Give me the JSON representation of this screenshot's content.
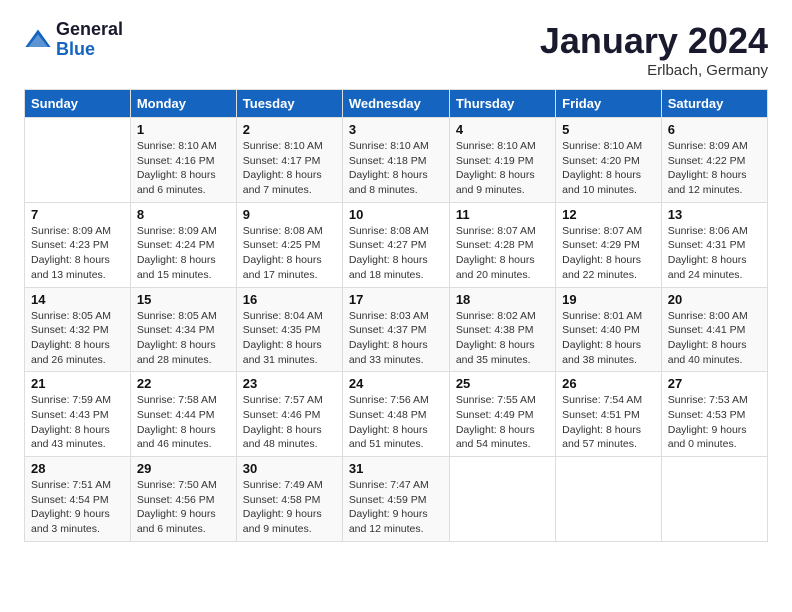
{
  "header": {
    "logo_general": "General",
    "logo_blue": "Blue",
    "month": "January 2024",
    "location": "Erlbach, Germany"
  },
  "weekdays": [
    "Sunday",
    "Monday",
    "Tuesday",
    "Wednesday",
    "Thursday",
    "Friday",
    "Saturday"
  ],
  "weeks": [
    [
      {
        "day": "",
        "info": ""
      },
      {
        "day": "1",
        "info": "Sunrise: 8:10 AM\nSunset: 4:16 PM\nDaylight: 8 hours\nand 6 minutes."
      },
      {
        "day": "2",
        "info": "Sunrise: 8:10 AM\nSunset: 4:17 PM\nDaylight: 8 hours\nand 7 minutes."
      },
      {
        "day": "3",
        "info": "Sunrise: 8:10 AM\nSunset: 4:18 PM\nDaylight: 8 hours\nand 8 minutes."
      },
      {
        "day": "4",
        "info": "Sunrise: 8:10 AM\nSunset: 4:19 PM\nDaylight: 8 hours\nand 9 minutes."
      },
      {
        "day": "5",
        "info": "Sunrise: 8:10 AM\nSunset: 4:20 PM\nDaylight: 8 hours\nand 10 minutes."
      },
      {
        "day": "6",
        "info": "Sunrise: 8:09 AM\nSunset: 4:22 PM\nDaylight: 8 hours\nand 12 minutes."
      }
    ],
    [
      {
        "day": "7",
        "info": "Sunrise: 8:09 AM\nSunset: 4:23 PM\nDaylight: 8 hours\nand 13 minutes."
      },
      {
        "day": "8",
        "info": "Sunrise: 8:09 AM\nSunset: 4:24 PM\nDaylight: 8 hours\nand 15 minutes."
      },
      {
        "day": "9",
        "info": "Sunrise: 8:08 AM\nSunset: 4:25 PM\nDaylight: 8 hours\nand 17 minutes."
      },
      {
        "day": "10",
        "info": "Sunrise: 8:08 AM\nSunset: 4:27 PM\nDaylight: 8 hours\nand 18 minutes."
      },
      {
        "day": "11",
        "info": "Sunrise: 8:07 AM\nSunset: 4:28 PM\nDaylight: 8 hours\nand 20 minutes."
      },
      {
        "day": "12",
        "info": "Sunrise: 8:07 AM\nSunset: 4:29 PM\nDaylight: 8 hours\nand 22 minutes."
      },
      {
        "day": "13",
        "info": "Sunrise: 8:06 AM\nSunset: 4:31 PM\nDaylight: 8 hours\nand 24 minutes."
      }
    ],
    [
      {
        "day": "14",
        "info": "Sunrise: 8:05 AM\nSunset: 4:32 PM\nDaylight: 8 hours\nand 26 minutes."
      },
      {
        "day": "15",
        "info": "Sunrise: 8:05 AM\nSunset: 4:34 PM\nDaylight: 8 hours\nand 28 minutes."
      },
      {
        "day": "16",
        "info": "Sunrise: 8:04 AM\nSunset: 4:35 PM\nDaylight: 8 hours\nand 31 minutes."
      },
      {
        "day": "17",
        "info": "Sunrise: 8:03 AM\nSunset: 4:37 PM\nDaylight: 8 hours\nand 33 minutes."
      },
      {
        "day": "18",
        "info": "Sunrise: 8:02 AM\nSunset: 4:38 PM\nDaylight: 8 hours\nand 35 minutes."
      },
      {
        "day": "19",
        "info": "Sunrise: 8:01 AM\nSunset: 4:40 PM\nDaylight: 8 hours\nand 38 minutes."
      },
      {
        "day": "20",
        "info": "Sunrise: 8:00 AM\nSunset: 4:41 PM\nDaylight: 8 hours\nand 40 minutes."
      }
    ],
    [
      {
        "day": "21",
        "info": "Sunrise: 7:59 AM\nSunset: 4:43 PM\nDaylight: 8 hours\nand 43 minutes."
      },
      {
        "day": "22",
        "info": "Sunrise: 7:58 AM\nSunset: 4:44 PM\nDaylight: 8 hours\nand 46 minutes."
      },
      {
        "day": "23",
        "info": "Sunrise: 7:57 AM\nSunset: 4:46 PM\nDaylight: 8 hours\nand 48 minutes."
      },
      {
        "day": "24",
        "info": "Sunrise: 7:56 AM\nSunset: 4:48 PM\nDaylight: 8 hours\nand 51 minutes."
      },
      {
        "day": "25",
        "info": "Sunrise: 7:55 AM\nSunset: 4:49 PM\nDaylight: 8 hours\nand 54 minutes."
      },
      {
        "day": "26",
        "info": "Sunrise: 7:54 AM\nSunset: 4:51 PM\nDaylight: 8 hours\nand 57 minutes."
      },
      {
        "day": "27",
        "info": "Sunrise: 7:53 AM\nSunset: 4:53 PM\nDaylight: 9 hours\nand 0 minutes."
      }
    ],
    [
      {
        "day": "28",
        "info": "Sunrise: 7:51 AM\nSunset: 4:54 PM\nDaylight: 9 hours\nand 3 minutes."
      },
      {
        "day": "29",
        "info": "Sunrise: 7:50 AM\nSunset: 4:56 PM\nDaylight: 9 hours\nand 6 minutes."
      },
      {
        "day": "30",
        "info": "Sunrise: 7:49 AM\nSunset: 4:58 PM\nDaylight: 9 hours\nand 9 minutes."
      },
      {
        "day": "31",
        "info": "Sunrise: 7:47 AM\nSunset: 4:59 PM\nDaylight: 9 hours\nand 12 minutes."
      },
      {
        "day": "",
        "info": ""
      },
      {
        "day": "",
        "info": ""
      },
      {
        "day": "",
        "info": ""
      }
    ]
  ]
}
